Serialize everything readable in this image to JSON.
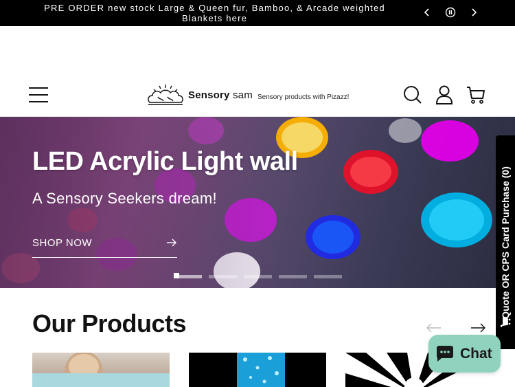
{
  "announcement": {
    "text": "PRE ORDER new stock Large & Queen fur, Bamboo, & Arcade weighted Blankets here",
    "prev_icon": "chevron-left-icon",
    "pause_icon": "pause-circle-icon",
    "next_icon": "chevron-right-icon"
  },
  "header": {
    "logo_bold": "Sensory",
    "logo_light": " sam",
    "tagline": "Sensory products with Pizazz!",
    "icons": [
      "menu-icon",
      "search-icon",
      "account-icon",
      "cart-icon"
    ]
  },
  "hero": {
    "title": "LED Acrylic Light wall",
    "subtitle": "A Sensory Seekers dream!",
    "cta": "SHOP NOW",
    "slide_count": 5,
    "active_slide": 1
  },
  "side_tab": {
    "label": "Quote OR CPS Card Purchase (0)"
  },
  "products": {
    "title": "Our Products"
  },
  "chat": {
    "label": "Chat"
  },
  "colors": {
    "announcement_bg": "#000000",
    "chat_bg": "#8fd3bf",
    "text": "#121212"
  }
}
